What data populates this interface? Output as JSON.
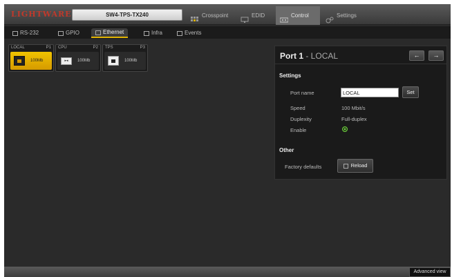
{
  "header": {
    "logo": "LIGHTWARE",
    "device_name": "SW4-TPS-TX240",
    "nav_tabs": [
      {
        "label": "Crosspoint",
        "icon": "crosspoint-icon"
      },
      {
        "label": "EDID",
        "icon": "edid-icon"
      },
      {
        "label": "Control",
        "icon": "control-icon",
        "active": true
      },
      {
        "label": "Settings",
        "icon": "settings-icon"
      }
    ]
  },
  "subtabs": [
    {
      "label": "RS-232",
      "icon": "rs232-icon"
    },
    {
      "label": "GPIO",
      "icon": "gpio-icon"
    },
    {
      "label": "Ethernet",
      "icon": "ethernet-icon",
      "active": true
    },
    {
      "label": "Infra",
      "icon": "infra-icon"
    },
    {
      "label": "Events",
      "icon": "events-icon"
    }
  ],
  "ports": [
    {
      "name": "LOCAL",
      "num": "P1",
      "speed": "100Mb",
      "selected": true
    },
    {
      "name": "CPU",
      "num": "P2",
      "speed": "100Mb"
    },
    {
      "name": "TPS",
      "num": "P3",
      "speed": "100Mb"
    }
  ],
  "panel": {
    "title": "Port 1",
    "subtitle": " - LOCAL",
    "prev_icon": "←",
    "next_icon": "→",
    "settings_heading": "Settings",
    "port_name_label": "Port name",
    "port_name_value": "LOCAL",
    "set_label": "Set",
    "speed_label": "Speed",
    "speed_value": "100 Mbit/s",
    "duplexity_label": "Duplexity",
    "duplexity_value": "Full-duplex",
    "enable_label": "Enable",
    "other_heading": "Other",
    "factory_label": "Factory defaults",
    "reload_label": "Reload"
  },
  "footer": {
    "advanced_view": "Advanced view"
  },
  "colors": {
    "accent": "#e2b400",
    "selected_tile": "#f0c300",
    "enable_ok": "#6fcf3f"
  }
}
